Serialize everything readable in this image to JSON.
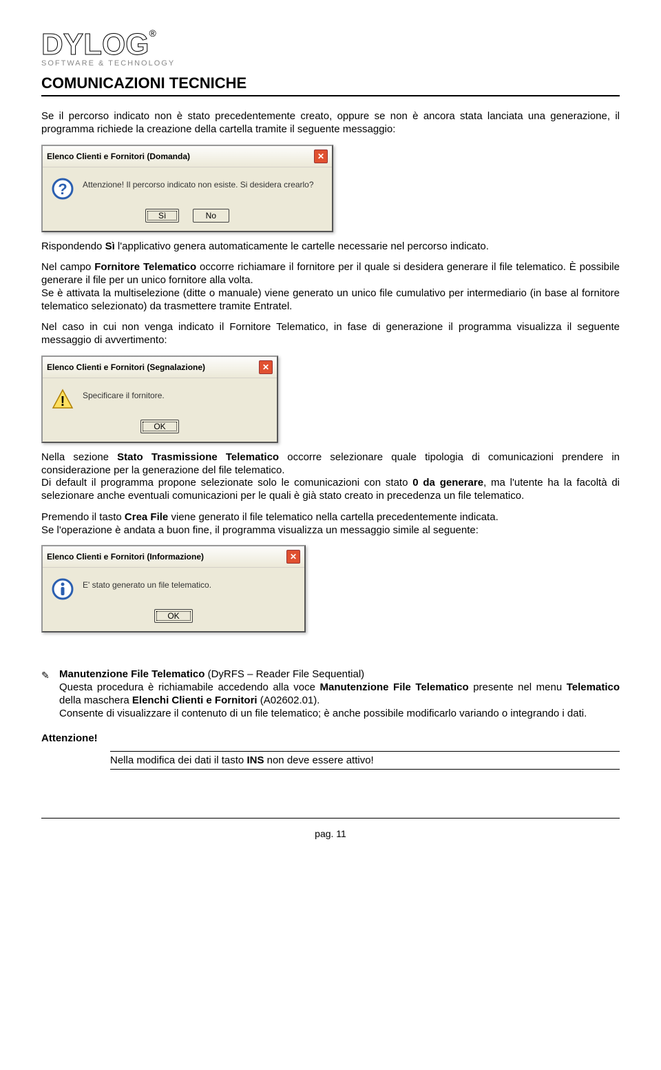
{
  "header": {
    "logo_text": "DYLOG",
    "logo_reg": "®",
    "logo_sub": "SOFTWARE & TECHNOLOGY",
    "section_title": "COMUNICAZIONI TECNICHE"
  },
  "para1": "Se il percorso indicato non è stato precedentemente creato, oppure se non è ancora stata lanciata una generazione, il programma richiede la creazione della cartella tramite il seguente messaggio:",
  "dialog1": {
    "title": "Elenco Clienti e Fornitori   (Domanda)",
    "message": "Attenzione! Il percorso indicato non esiste. Si desidera crearlo?",
    "btn_yes": "Sì",
    "btn_no": "No"
  },
  "para2_pre": "Rispondendo ",
  "para2_b": "Sì",
  "para2_post": " l'applicativo genera automaticamente le cartelle necessarie nel percorso indicato.",
  "para3_pre": "Nel campo ",
  "para3_b": "Fornitore Telematico",
  "para3_post": " occorre richiamare il fornitore per il quale si desidera generare il file telematico. È possibile generare il file per un unico fornitore alla volta.",
  "para3b": "Se è attivata la multiselezione (ditte o manuale) viene generato un unico file cumulativo per intermediario (in base al fornitore telematico selezionato) da trasmettere tramite Entratel.",
  "para4": "Nel caso in cui non venga indicato il Fornitore Telematico, in fase di generazione il programma visualizza il seguente messaggio di avvertimento:",
  "dialog2": {
    "title": "Elenco Clienti e Fornitori   (Segnalazione)",
    "message": "Specificare il fornitore.",
    "btn_ok": "OK"
  },
  "para5_pre": "Nella sezione ",
  "para5_b": "Stato Trasmissione Telematico",
  "para5_post": " occorre selezionare quale tipologia di comunicazioni prendere in considerazione per la generazione del file telematico.",
  "para5b_pre": "Di default il programma propone selezionate solo le comunicazioni con stato ",
  "para5b_b": "0 da generare",
  "para5b_post": ", ma l'utente ha la facoltà di selezionare anche eventuali comunicazioni per le quali è già stato creato in precedenza un file telematico.",
  "para6_pre": "Premendo il tasto ",
  "para6_b": "Crea File",
  "para6_post": " viene generato il file telematico nella cartella precedentemente indicata.",
  "para6b": "Se l'operazione è andata a buon fine, il programma visualizza un messaggio simile al seguente:",
  "dialog3": {
    "title": "Elenco Clienti e Fornitori   (Informazione)",
    "message": "E' stato generato un file telematico.",
    "btn_ok": "OK"
  },
  "bullet": {
    "title_b": "Manutenzione File Telematico",
    "title_rest": " (DyRFS – Reader File Sequential)",
    "line2_pre": "Questa procedura è richiamabile accedendo alla voce ",
    "line2_b": "Manutenzione File Telematico",
    "line2_mid": " presente nel menu ",
    "line2_b2": "Telematico",
    "line2_mid2": " della maschera ",
    "line2_b3": "Elenchi Clienti e Fornitori",
    "line2_post": " (A02602.01).",
    "line3": "Consente di visualizzare il contenuto di un file telematico; è anche possibile modificarlo variando o integrando i dati."
  },
  "attention_label": "Attenzione!",
  "note_pre": "Nella modifica dei dati il tasto ",
  "note_b": "INS",
  "note_post": " non deve essere attivo!",
  "footer": {
    "pagenum": "pag. 11"
  }
}
